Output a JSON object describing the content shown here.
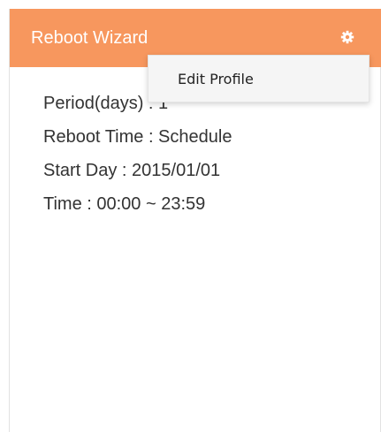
{
  "panel": {
    "title": "Reboot Wizard",
    "settings_icon": "gear-icon",
    "header_color": "#f7975e",
    "lines": [
      "Period(days) : 1",
      "Reboot Time : Schedule",
      "Start Day : 2015/01/01",
      "Time : 00:00 ~ 23:59"
    ]
  },
  "menu": {
    "items": [
      {
        "label": "Edit Profile"
      }
    ]
  }
}
